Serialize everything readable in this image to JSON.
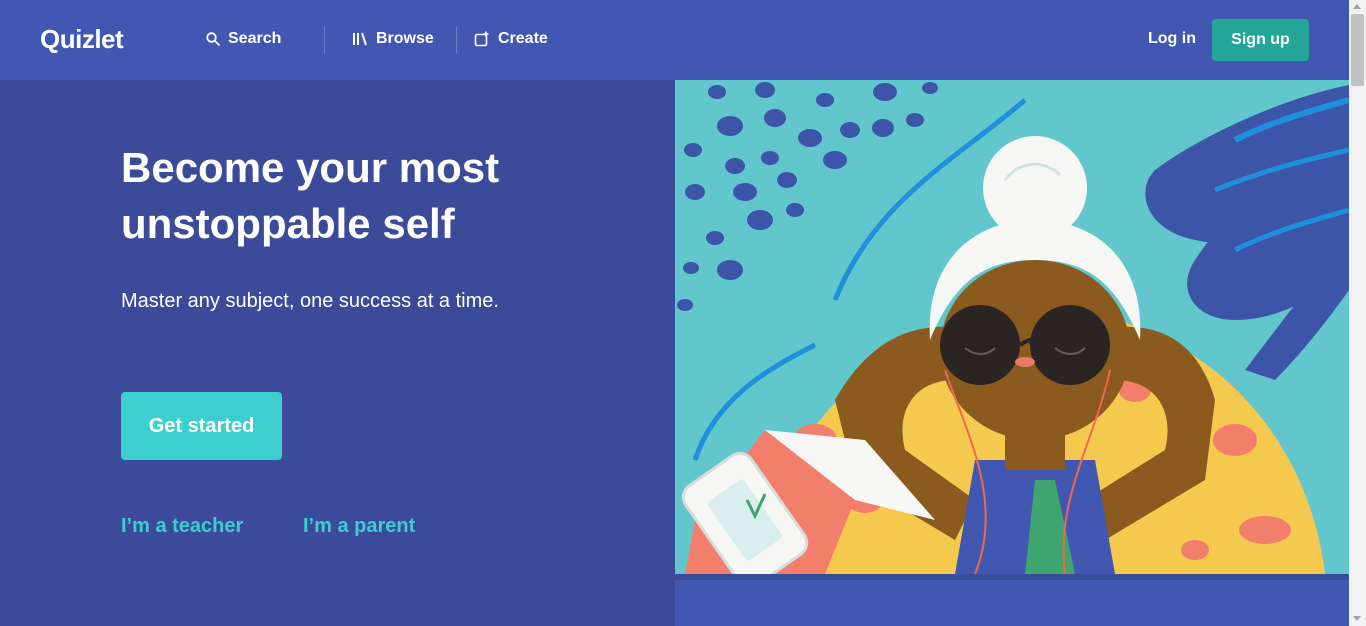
{
  "header": {
    "logo": "Quizlet",
    "nav": {
      "search_label": "Search",
      "browse_label": "Browse",
      "create_label": "Create"
    },
    "login_label": "Log in",
    "signup_label": "Sign up"
  },
  "hero": {
    "headline_line1": "Become your most",
    "headline_line2": "unstoppable self",
    "subhead": "Master any subject, one success at a time.",
    "cta_label": "Get started",
    "teacher_link": "I’m a teacher",
    "parent_link": "I’m a parent"
  },
  "colors": {
    "header_bg": "#4257b2",
    "hero_bg": "#3c4a9a",
    "signup_bg": "#23a597",
    "cta_bg": "#3ccfcf",
    "link": "#3ccfcf"
  },
  "icons": {
    "search": "search-icon",
    "browse": "library-icon",
    "create": "create-icon"
  }
}
